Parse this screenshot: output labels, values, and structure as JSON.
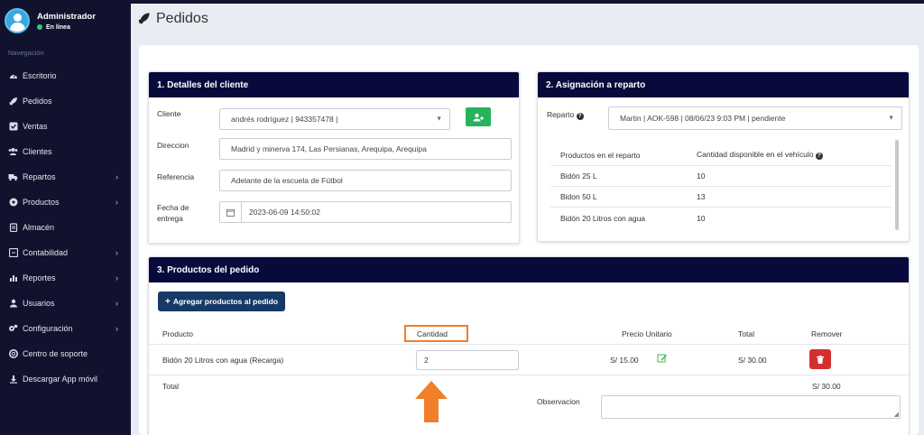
{
  "sidebar": {
    "user": {
      "name": "Administrador",
      "status": "En línea"
    },
    "nav_header": "Navegación",
    "items": [
      {
        "label": "Escritorio",
        "icon": "tachometer-icon",
        "has_children": false
      },
      {
        "label": "Pedidos",
        "icon": "rocket-icon",
        "has_children": false
      },
      {
        "label": "Ventas",
        "icon": "check-square-icon",
        "has_children": false
      },
      {
        "label": "Clientes",
        "icon": "users-icon",
        "has_children": false
      },
      {
        "label": "Repartos",
        "icon": "truck-icon",
        "has_children": true
      },
      {
        "label": "Productos",
        "icon": "box-icon",
        "has_children": true
      },
      {
        "label": "Almacén",
        "icon": "clipboard-icon",
        "has_children": false
      },
      {
        "label": "Contabilidad",
        "icon": "calculator-icon",
        "has_children": true
      },
      {
        "label": "Reportes",
        "icon": "bar-chart-icon",
        "has_children": true
      },
      {
        "label": "Usuarios",
        "icon": "user-icon",
        "has_children": true
      },
      {
        "label": "Configuración",
        "icon": "cogs-icon",
        "has_children": true
      },
      {
        "label": "Centro de soporte",
        "icon": "support-icon",
        "has_children": false
      },
      {
        "label": "Descargar App móvil",
        "icon": "download-icon",
        "has_children": false
      }
    ]
  },
  "page": {
    "title": "Pedidos"
  },
  "client": {
    "header": "1. Detalles del cliente",
    "client_label": "Cliente",
    "client_value": "andrés rodríguez | 943357478 |",
    "address_label": "Direccion",
    "address_value": "Madrid y minerva 174, Las Persianas, Arequipa, Arequipa",
    "reference_label": "Referencia",
    "reference_value": "Adelante de la escuela de Fútbol",
    "date_label": "Fecha de entrega",
    "date_value": "2023-06-09 14:50:02"
  },
  "delivery": {
    "header": "2. Asignación a reparto",
    "reparto_label": "Reparto",
    "reparto_value": "Martin | AOK-598 | 08/06/23 9:03 PM | pendiente",
    "col_products": "Productos en el reparto",
    "col_available": "Cantidad disponible en el vehículo",
    "rows": [
      {
        "product": "Bidón 25 L",
        "qty": "10"
      },
      {
        "product": "Bidon 50 L",
        "qty": "13"
      },
      {
        "product": "Bidón 20 Litros con agua",
        "qty": "10"
      }
    ]
  },
  "order": {
    "header": "3. Productos del pedido",
    "add_button": "Agregar productos al pedido",
    "col_product": "Producto",
    "col_quantity": "Cantidad",
    "col_unit_price": "Precio Unitario",
    "col_total": "Total",
    "col_remove": "Remover",
    "row": {
      "product": "Bidón 20 Litros con agua (Recarga)",
      "quantity": "2",
      "unit_price": "S/ 15.00",
      "total": "S/ 30.00"
    },
    "total_label": "Total",
    "total_value": "S/ 30.00",
    "observation_label": "Observacion"
  },
  "colors": {
    "sidebar_bg": "#11132e",
    "card_header": "#070a3a",
    "accent_orange": "#f07f2a",
    "success": "#27b35a",
    "danger": "#d32f2f",
    "primary_dark": "#163a66"
  }
}
